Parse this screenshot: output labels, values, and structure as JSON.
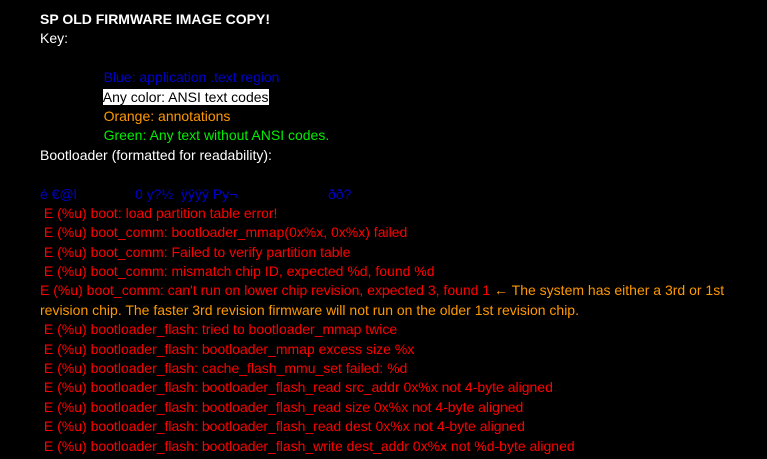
{
  "title": "SP OLD FIRMWARE IMAGE COPY!",
  "key": {
    "label": "Key:",
    "items": [
      "Blue: application .text region",
      "Any color: ANSI text codes",
      "Orange: annotations",
      "Green: Any text without ANSI codes."
    ]
  },
  "bootloader_heading": "Bootloader (formatted for readability):",
  "binary_line": {
    "seg1": "é €@l",
    "seg2": "0 y?½  ÿÿÿÿ Py¬",
    "seg3": "ðð?"
  },
  "log_lines": [
    " E (%u) boot: load partition table error!",
    " E (%u) boot_comm: bootloader_mmap(0x%x, 0x%x) failed",
    " E (%u) boot_comm: Failed to verify partition table",
    " E (%u) boot_comm: mismatch chip ID, expected %d, found %d"
  ],
  "revision_line": {
    "log": " E (%u) boot_comm: can't run on lower chip revision, expected 3, found 1",
    "annotation": " ← The system has either a 3rd or 1st revision chip. The faster 3rd revision firmware will not run on the older 1st revision chip."
  },
  "flash_lines": [
    " E (%u) bootloader_flash: tried to bootloader_mmap twice",
    " E (%u) bootloader_flash: bootloader_mmap excess size %x",
    " E (%u) bootloader_flash: cache_flash_mmu_set failed: %d",
    " E (%u) bootloader_flash: bootloader_flash_read src_addr 0x%x not 4-byte aligned",
    " E (%u) bootloader_flash: bootloader_flash_read size 0x%x not 4-byte aligned",
    " E (%u) bootloader_flash: bootloader_flash_read dest 0x%x not 4-byte aligned",
    " E (%u) bootloader_flash: bootloader_flash_write dest_addr 0x%x not %d-byte aligned"
  ],
  "colors": {
    "background": "#000000",
    "blue": "#0000cc",
    "red": "#ff0000",
    "orange": "#ff9900",
    "green": "#00ee00",
    "white": "#ffffff"
  }
}
